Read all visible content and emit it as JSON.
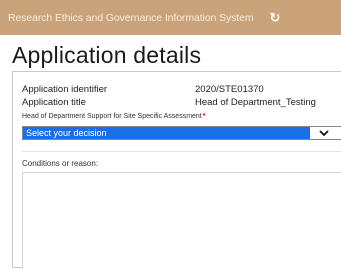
{
  "header": {
    "app_title": "Research Ethics and Governance Information System",
    "refresh_icon": "refresh-icon",
    "bar_color": "#cba37a"
  },
  "page": {
    "title": "Application details"
  },
  "details": {
    "identifier_label": "Application identifier",
    "identifier_value": "2020/STE01370",
    "title_label": "Application title",
    "title_value": "Head of Department_Testing"
  },
  "decision": {
    "label": "Head of Department Support for Site Specific Assessment",
    "required_marker": "*",
    "selected": "Select your decision",
    "chevron_icon": "chevron-down-icon",
    "highlight_color": "#1a6ee6"
  },
  "conditions": {
    "label": "Conditions or reason:",
    "value": ""
  }
}
